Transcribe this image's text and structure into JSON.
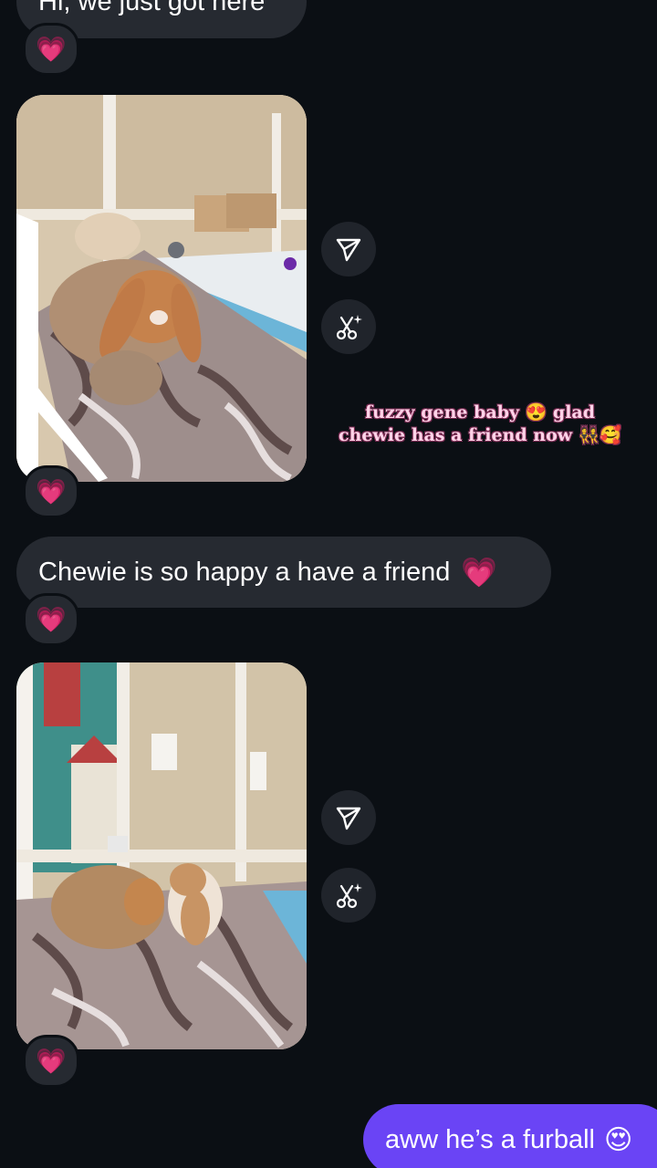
{
  "messages": {
    "m1_text": "Hi, we just got here",
    "m1_reaction": "💗",
    "photo1_reaction": "💗",
    "caption": "fuzzy gene baby 😍 glad chewie has a friend now 👯🥰",
    "m2_text": "Chewie is so happy a have a friend",
    "m2_emoji": "💗",
    "m2_reaction": "💗",
    "photo2_reaction": "💗",
    "out_text": "aww he’s a furball",
    "out_emoji": "😍"
  },
  "icons": {
    "share": "send-icon",
    "remix": "sparkle-scissors-icon"
  },
  "colors": {
    "background": "#0b0f14",
    "incoming_bubble": "#262a31",
    "outgoing_bubble": "#6a44f5",
    "caption_text": "#ffd3e8"
  }
}
